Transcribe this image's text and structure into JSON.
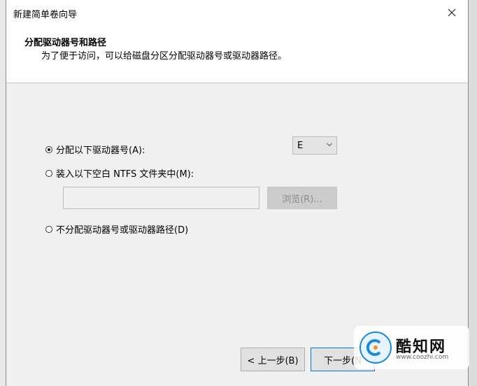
{
  "window": {
    "title": "新建简单卷向导"
  },
  "header": {
    "title": "分配驱动器号和路径",
    "subtitle": "为了便于访问，可以给磁盘分区分配驱动器号或驱动器路径。"
  },
  "options": {
    "assign_letter": {
      "label": "分配以下驱动器号(A):",
      "checked": true
    },
    "mount_folder": {
      "label": "装入以下空白 NTFS 文件夹中(M):",
      "checked": false
    },
    "no_assign": {
      "label": "不分配驱动器号或驱动器路径(D)",
      "checked": false
    }
  },
  "drive_letter": {
    "value": "E"
  },
  "folder_path": {
    "value": ""
  },
  "browse": {
    "label": "浏览(R)..."
  },
  "nav": {
    "back_label": "< 上一步(B)",
    "next_label": "下一步(N"
  },
  "watermark": {
    "name": "酷知网",
    "url": "www.coozhi.com"
  }
}
